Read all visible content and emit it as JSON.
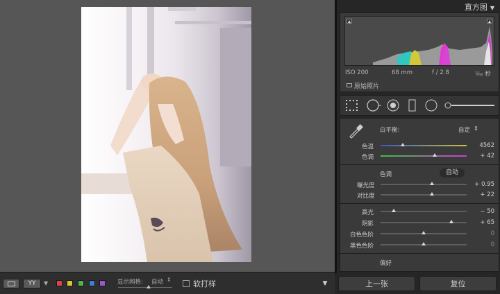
{
  "toolbar": {
    "compare_label": "YY",
    "color_labels": [
      "#d94545",
      "#d7c737",
      "#52b24c",
      "#3f7fd0",
      "#9b55cf"
    ],
    "grid_label": "显示网格:",
    "grid_value": "自动",
    "softproof_label": "软打样"
  },
  "histogram": {
    "title": "直方图",
    "iso": "ISO 200",
    "focal": "68 mm",
    "aperture": "f / 2.8",
    "shutter": "¹⁄₆₀ 秒",
    "original_label": "原始照片"
  },
  "basic": {
    "wb_label": "白平衡:",
    "wb_value": "自定",
    "temp_label": "色温",
    "temp_value": "4562",
    "tint_label": "色调",
    "tint_value": "+ 42",
    "tone_label": "色调",
    "auto_label": "自动",
    "exposure_label": "曝光度",
    "exposure_value": "+ 0.95",
    "contrast_label": "对比度",
    "contrast_value": "+ 22",
    "highlights_label": "高光",
    "highlights_value": "− 50",
    "shadows_label": "阴影",
    "shadows_value": "+ 65",
    "whites_label": "白色色阶",
    "whites_value": "0",
    "blacks_label": "黑色色阶",
    "blacks_value": "0",
    "presence_label": "偏好"
  },
  "slider_levels": {
    "temp": 0.26,
    "tint": 0.63,
    "exposure": 0.6,
    "contrast": 0.6,
    "highlights": 0.15,
    "shadows": 0.82,
    "whites": 0.5,
    "blacks": 0.5
  },
  "buttons": {
    "prev": "上一张",
    "reset": "复位"
  }
}
